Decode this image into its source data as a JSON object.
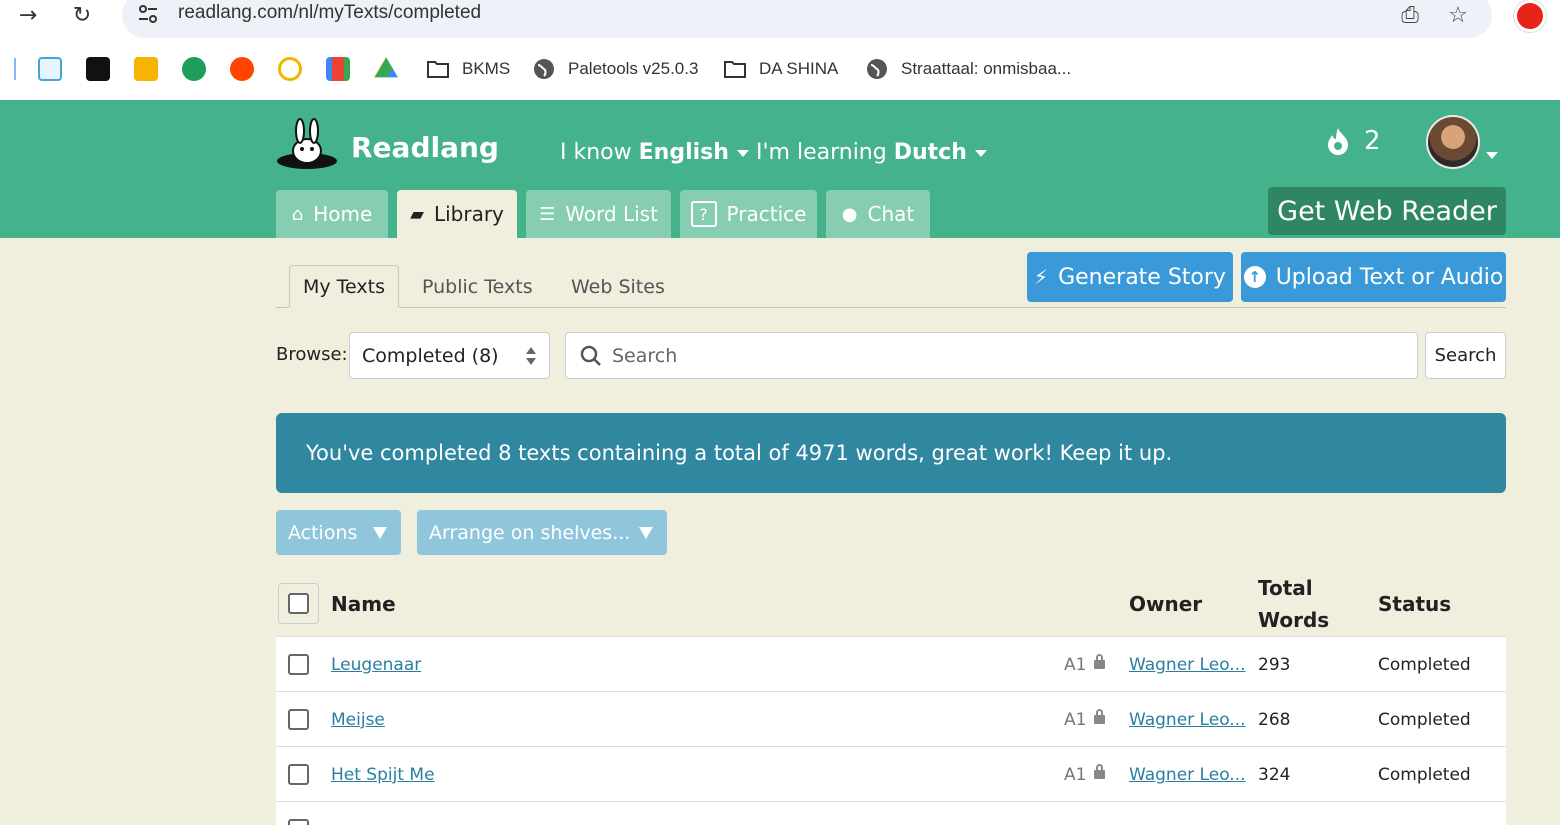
{
  "browser": {
    "url": "readlang.com/nl/myTexts/completed",
    "bookmarks": [
      "BKMS",
      "Paletools v25.0.3",
      "DA SHINA",
      "Straattaal: onmisbaa..."
    ]
  },
  "header": {
    "brand": "Readlang",
    "know_prefix": "I know",
    "know_lang": "English",
    "learning_prefix": "I'm learning",
    "learning_lang": "Dutch",
    "streak": "2",
    "get_web_reader": "Get Web Reader"
  },
  "tabs": [
    {
      "label": "Home",
      "icon": "home-icon"
    },
    {
      "label": "Library",
      "icon": "book-icon"
    },
    {
      "label": "Word List",
      "icon": "list-icon"
    },
    {
      "label": "Practice",
      "icon": "question-icon"
    },
    {
      "label": "Chat",
      "icon": "chat-icon"
    }
  ],
  "subtabs": [
    "My Texts",
    "Public Texts",
    "Web Sites"
  ],
  "buttons": {
    "generate_story": "Generate Story",
    "upload": "Upload Text or Audio",
    "search": "Search",
    "actions": "Actions",
    "arrange": "Arrange on shelves..."
  },
  "browse": {
    "label": "Browse:",
    "selected": "Completed (8)",
    "search_placeholder": "Search"
  },
  "banner": "You've completed 8 texts containing a total of 4971 words, great work! Keep it up.",
  "table": {
    "headers": {
      "name": "Name",
      "owner": "Owner",
      "total_words_1": "Total",
      "total_words_2": "Words",
      "status": "Status"
    },
    "rows": [
      {
        "name": "Leugenaar",
        "level": "A1",
        "owner": "Wagner Leo...",
        "words": "293",
        "status": "Completed"
      },
      {
        "name": "Meijse",
        "level": "A1",
        "owner": "Wagner Leo...",
        "words": "268",
        "status": "Completed"
      },
      {
        "name": "Het Spijt Me",
        "level": "A1",
        "owner": "Wagner Leo...",
        "words": "324",
        "status": "Completed"
      }
    ]
  },
  "colors": {
    "header_green": "#44b28a",
    "banner": "#2f87a0",
    "button_blue": "#3a9ad9"
  }
}
